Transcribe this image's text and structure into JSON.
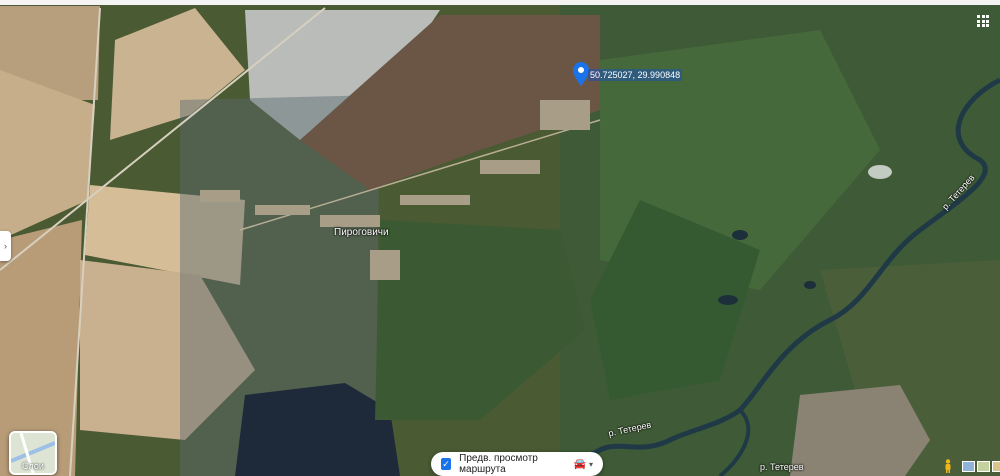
{
  "map": {
    "view": "satellite",
    "marker": {
      "icon": "location-pin-icon",
      "coordinates_label": "50.725027, 29.990848",
      "color": "#1a73e8"
    },
    "place_label": "Пироговичи",
    "river_labels": [
      "р. Тетерев",
      "р. Тетерев",
      "р. Тетерев"
    ]
  },
  "controls": {
    "apps_icon": "apps-grid-icon",
    "side_toggle_glyph": "›",
    "layers_label": "Слои",
    "route_preview": {
      "checked": true,
      "label": "Предв. просмотр маршрута",
      "icon": "car-icon"
    },
    "pegman_icon": "pegman-icon"
  }
}
